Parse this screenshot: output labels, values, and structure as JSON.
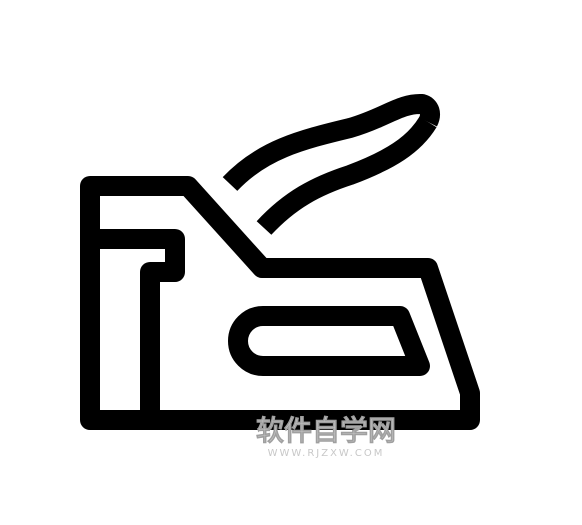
{
  "icon": {
    "name": "staple-gun-icon",
    "stroke_color": "#000000",
    "background_color": "#ffffff"
  },
  "watermark": {
    "title": "软件自学网",
    "subtitle": "WWW.RJZXW.COM",
    "color": "#c8c8c8"
  }
}
